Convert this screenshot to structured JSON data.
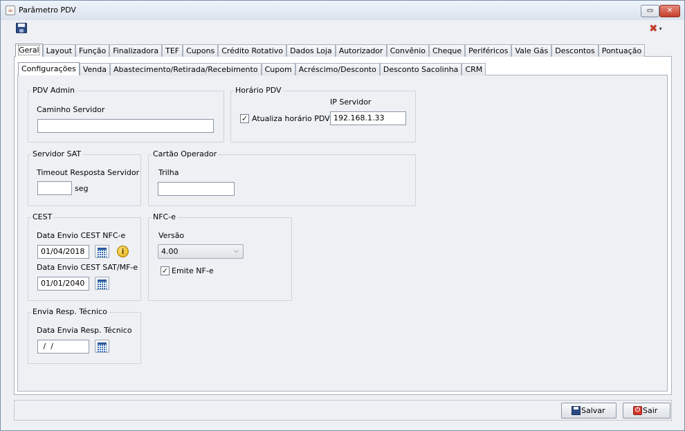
{
  "window": {
    "title": "Parâmetro PDV"
  },
  "main_tabs": [
    {
      "label": "Geral",
      "active": true
    },
    {
      "label": "Layout"
    },
    {
      "label": "Função"
    },
    {
      "label": "Finalizadora"
    },
    {
      "label": "TEF"
    },
    {
      "label": "Cupons"
    },
    {
      "label": "Crédito Rotativo"
    },
    {
      "label": "Dados Loja"
    },
    {
      "label": "Autorizador"
    },
    {
      "label": "Convênio"
    },
    {
      "label": "Cheque"
    },
    {
      "label": "Periféricos"
    },
    {
      "label": "Vale Gás"
    },
    {
      "label": "Descontos"
    },
    {
      "label": "Pontuação"
    }
  ],
  "sub_tabs": [
    {
      "label": "Configurações",
      "active": true
    },
    {
      "label": "Venda"
    },
    {
      "label": "Abastecimento/Retirada/Recebimento"
    },
    {
      "label": "Cupom"
    },
    {
      "label": "Acréscimo/Desconto"
    },
    {
      "label": "Desconto Sacolinha"
    },
    {
      "label": "CRM"
    }
  ],
  "pdv_admin": {
    "title": "PDV Admin",
    "caminho_label": "Caminho Servidor",
    "caminho_value": ""
  },
  "horario_pdv": {
    "title": "Horário PDV",
    "atualiza_label": "Atualiza horário PDV",
    "atualiza_checked": true,
    "ip_label": "IP Servidor",
    "ip_value": "192.168.1.33"
  },
  "servidor_sat": {
    "title": "Servidor SAT",
    "timeout_label": "Timeout Resposta Servidor",
    "timeout_value": "",
    "unit": "seg"
  },
  "cartao_operador": {
    "title": "Cartão Operador",
    "trilha_label": "Trilha",
    "trilha_value": ""
  },
  "cest": {
    "title": "CEST",
    "nfce_label": "Data Envio CEST NFC-e",
    "nfce_value": "01/04/2018",
    "sat_label": "Data Envio CEST SAT/MF-e",
    "sat_value": "01/01/2040"
  },
  "nfce": {
    "title": "NFC-e",
    "versao_label": "Versão",
    "versao_value": "4.00",
    "emite_label": "Emite NF-e",
    "emite_checked": true
  },
  "resp_tecnico": {
    "title": "Envia Resp. Técnico",
    "data_label": "Data Envia Resp. Técnico",
    "data_value": " /  /"
  },
  "buttons": {
    "salvar": "Salvar",
    "sair": "Sair"
  },
  "glyphs": {
    "check": "✓",
    "info": "i",
    "chevron": "⌵",
    "tools": "✖",
    "dropdown": "▾",
    "restore": "▭",
    "close": "✕",
    "app": "☕",
    "exit": "⏻"
  }
}
